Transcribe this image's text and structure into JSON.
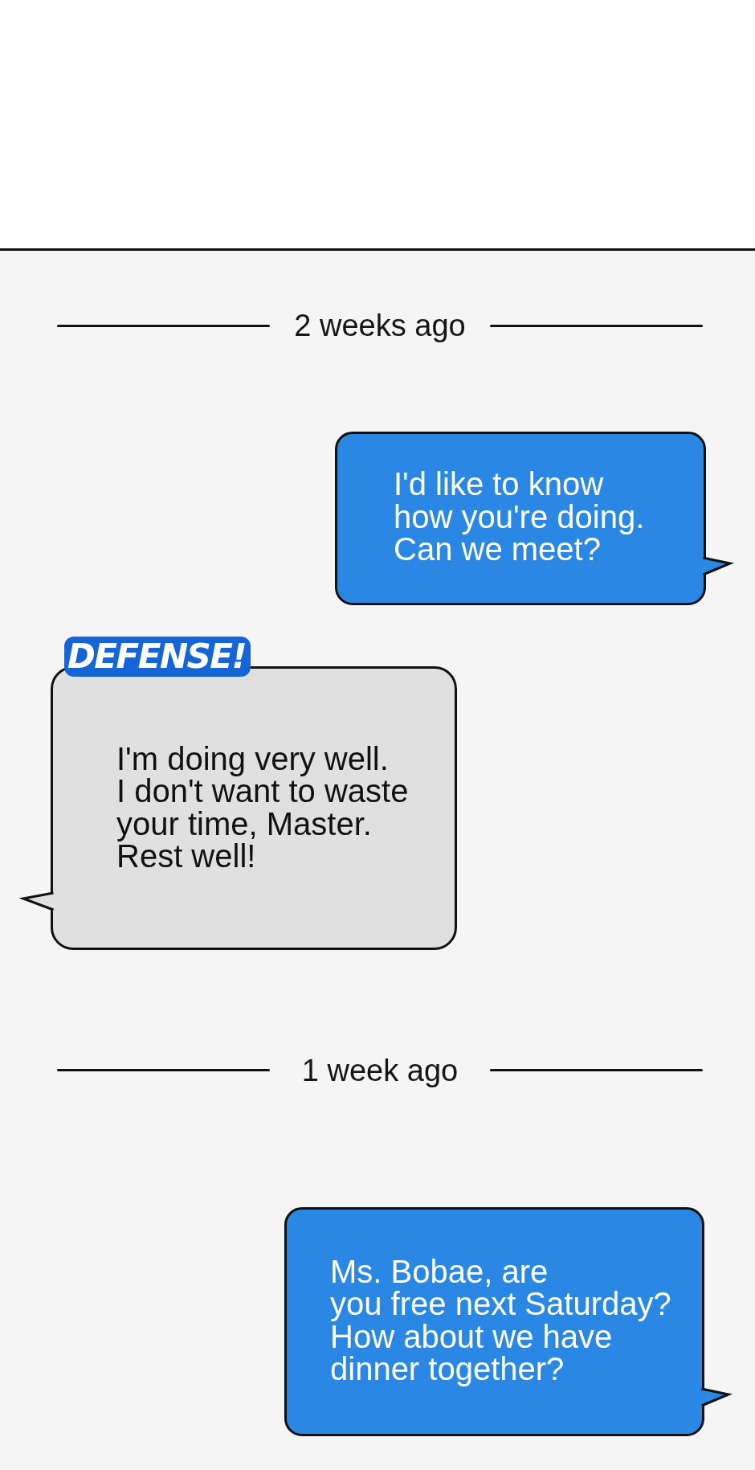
{
  "feed": [
    {
      "kind": "divider",
      "label": "2 weeks ago"
    },
    {
      "kind": "sent",
      "text": "I'd like to know\nhow you're doing.\nCan we meet?"
    },
    {
      "kind": "received",
      "sfx": "DEFENSE!",
      "text": "I'm doing very well.\nI don't want to waste\nyour time, Master.\nRest well!"
    },
    {
      "kind": "divider",
      "label": "1 week ago"
    },
    {
      "kind": "sent",
      "text": "Ms. Bobae, are\nyou free next Saturday?\nHow about we have\ndinner together?"
    }
  ]
}
